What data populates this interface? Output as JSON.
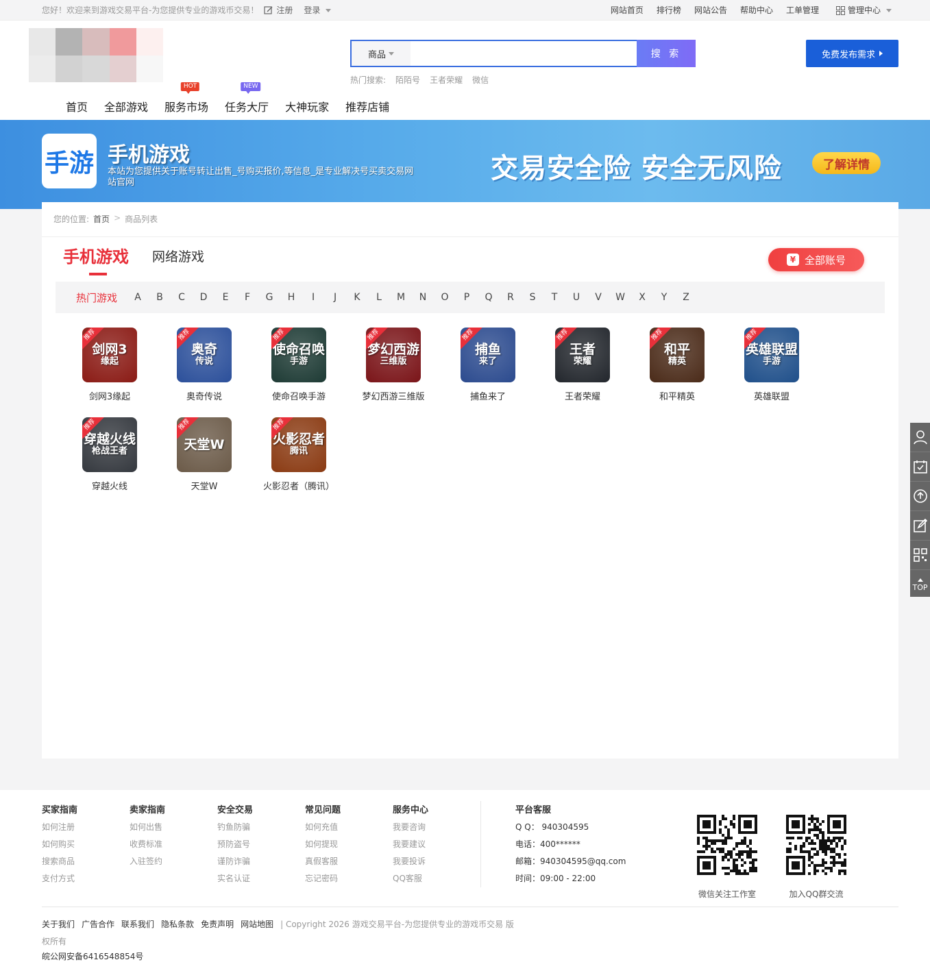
{
  "topbar": {
    "welcome": "您好！欢迎来到游戏交易平台-为您提供专业的游戏币交易！",
    "register": "注册",
    "login": "登录",
    "links": [
      "网站首页",
      "排行榜",
      "网站公告",
      "帮助中心",
      "工单管理"
    ],
    "admin": "管理中心"
  },
  "search": {
    "category": "商品",
    "placeholder": "",
    "button": "搜 索",
    "hot_label": "热门搜索:",
    "hot_terms": [
      "陌陌号",
      "王者荣耀",
      "微信"
    ]
  },
  "publish_button": "免费发布需求",
  "nav": {
    "items": [
      "首页",
      "全部游戏",
      "服务市场",
      "任务大厅",
      "大神玩家",
      "推荐店铺"
    ],
    "badges": {
      "hot": "HOT",
      "new": "NEW"
    }
  },
  "banner": {
    "icon_text": "手游",
    "title": "手机游戏",
    "desc": "本站为您提供关于账号转让出售_号购买报价,等信息_是专业解决号买卖交易网站官网",
    "slogan": "交易安全险 安全无风险",
    "more": "了解详情"
  },
  "breadcrumb": {
    "label": "您的位置:",
    "home": "首页",
    "current": "商品列表"
  },
  "tabs": [
    "手机游戏",
    "网络游戏"
  ],
  "all_accounts": "全部账号",
  "letters": {
    "hot": "热门游戏",
    "items": [
      "A",
      "B",
      "C",
      "D",
      "E",
      "F",
      "G",
      "H",
      "I",
      "J",
      "K",
      "L",
      "M",
      "N",
      "O",
      "P",
      "Q",
      "R",
      "S",
      "T",
      "U",
      "V",
      "W",
      "X",
      "Y",
      "Z"
    ]
  },
  "games": [
    {
      "name": "剑网3缘起",
      "l1": "剑网3",
      "l2": "缘起",
      "color": "#8a1a14"
    },
    {
      "name": "奥奇传说",
      "l1": "奥奇",
      "l2": "传说",
      "color": "#2b4f9a"
    },
    {
      "name": "使命召唤手游",
      "l1": "使命召唤",
      "l2": "手游",
      "color": "#1d3a34"
    },
    {
      "name": "梦幻西游三维版",
      "l1": "梦幻西游",
      "l2": "三维版",
      "color": "#7a1418"
    },
    {
      "name": "捕鱼来了",
      "l1": "捕鱼",
      "l2": "来了",
      "color": "#2b4a8e"
    },
    {
      "name": "王者荣耀",
      "l1": "王者",
      "l2": "荣耀",
      "color": "#22262c"
    },
    {
      "name": "和平精英",
      "l1": "和平",
      "l2": "精英",
      "color": "#4a2a18"
    },
    {
      "name": "英雄联盟",
      "l1": "英雄联盟",
      "l2": "手游",
      "color": "#1f4f8a"
    },
    {
      "name": "穿越火线",
      "l1": "穿越火线",
      "l2": "枪战王者",
      "color": "#34383e"
    },
    {
      "name": "天堂W",
      "l1": "天堂W",
      "l2": "",
      "color": "#6b5a48"
    },
    {
      "name": "火影忍者（腾讯）",
      "l1": "火影忍者",
      "l2": "腾讯",
      "color": "#8a3a12"
    }
  ],
  "tag": "推荐",
  "side": {
    "top": "TOP"
  },
  "footer": {
    "cols": [
      {
        "title": "买家指南",
        "items": [
          "如何注册",
          "如何购买",
          "搜索商品",
          "支付方式"
        ]
      },
      {
        "title": "卖家指南",
        "items": [
          "如何出售",
          "收费标准",
          "入驻签约"
        ]
      },
      {
        "title": "安全交易",
        "items": [
          "钓鱼防骗",
          "预防盗号",
          "谨防诈骗",
          "实名认证"
        ]
      },
      {
        "title": "常见问题",
        "items": [
          "如何充值",
          "如何提现",
          "真假客服",
          "忘记密码"
        ]
      },
      {
        "title": "服务中心",
        "items": [
          "我要咨询",
          "我要建议",
          "我要投诉",
          "QQ客服"
        ]
      }
    ],
    "service": {
      "title": "平台客服",
      "qq": "Q Q： 940304595",
      "phone": "电话：400******",
      "email": "邮箱：940304595@qq.com",
      "time": "时间：09:00 - 22:00"
    },
    "qr1": "微信关注工作室",
    "qr2": "加入QQ群交流",
    "links": [
      "关于我们",
      "广告合作",
      "联系我们",
      "隐私条款",
      "免责声明",
      "网站地图"
    ],
    "copyright": "| Copyright 2026 游戏交易平台-为您提供专业的游戏币交易 版权所有",
    "icp": "皖公网安备6416548854号"
  }
}
